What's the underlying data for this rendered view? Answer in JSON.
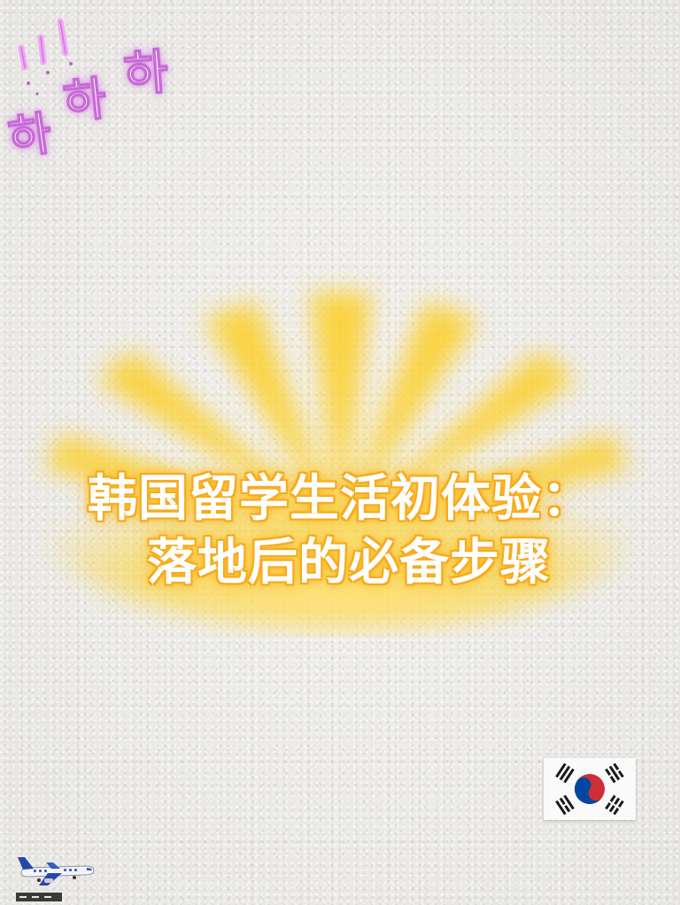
{
  "decoration": {
    "ha_1": "하",
    "ha_2": "하",
    "ha_3": "하"
  },
  "title": {
    "line1": "韩国留学生活初体验：",
    "line2": "落地后的必备步骤"
  },
  "icons": {
    "flag": "south-korea-flag-icon",
    "airplane": "airplane-icon",
    "sunburst": "sunburst-glow"
  },
  "colors": {
    "background": "#ecebe8",
    "title_fill": "#ffffff",
    "title_glow": "#f6a91c",
    "sun_yellow": "#fcd43a",
    "korean_text_stroke": "#c76ad6"
  }
}
